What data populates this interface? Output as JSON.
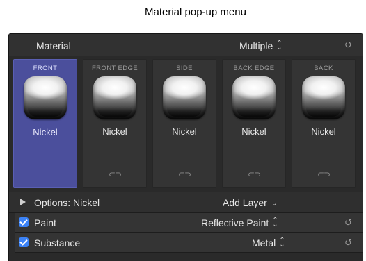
{
  "callout": {
    "label": "Material pop-up menu"
  },
  "header": {
    "title": "Material",
    "popup_value": "Multiple",
    "updown_glyph": "⌃⌄",
    "reset_glyph": "↺"
  },
  "tiles": [
    {
      "label": "FRONT",
      "name": "Nickel",
      "selected": true
    },
    {
      "label": "FRONT EDGE",
      "name": "Nickel",
      "link": "⊂⊃"
    },
    {
      "label": "SIDE",
      "name": "Nickel",
      "link": "⊂⊃"
    },
    {
      "label": "BACK EDGE",
      "name": "Nickel",
      "link": "⊂⊃"
    },
    {
      "label": "BACK",
      "name": "Nickel",
      "link": "⊂⊃"
    }
  ],
  "options_row": {
    "options_label": "Options: Nickel",
    "add_layer_label": "Add Layer",
    "chevron_glyph": "⌄"
  },
  "rows": [
    {
      "label": "Paint",
      "value": "Reflective Paint",
      "checked": true
    },
    {
      "label": "Substance",
      "value": "Metal",
      "checked": true
    }
  ],
  "colors": {
    "selected_tile": "#4b4f9c",
    "checkbox": "#3b82f6",
    "panel_bg": "#2a2a2a"
  }
}
